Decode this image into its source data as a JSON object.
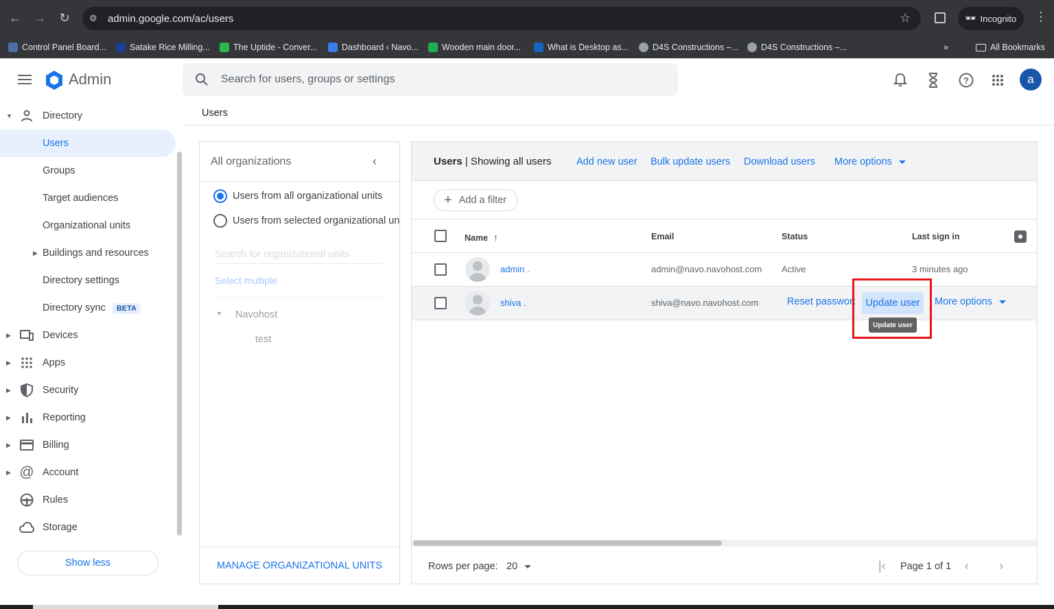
{
  "browser": {
    "url": "admin.google.com/ac/users",
    "incognito_label": "Incognito",
    "all_bookmarks_label": "All Bookmarks",
    "bookmarks": [
      {
        "label": "Control Panel Board...",
        "color": "#4a6fa5"
      },
      {
        "label": "Satake Rice Milling...",
        "color": "#1c3f94"
      },
      {
        "label": "The Uptide - Conver...",
        "color": "#2db84d"
      },
      {
        "label": "Dashboard ‹ Navo...",
        "color": "#3b7ded"
      },
      {
        "label": "Wooden main door...",
        "color": "#1fae52"
      },
      {
        "label": "What is Desktop as...",
        "color": "#1565c0"
      },
      {
        "label": "D4S Constructions –...",
        "color": "#9aa0a6"
      },
      {
        "label": "D4S Constructions –...",
        "color": "#9aa0a6"
      }
    ]
  },
  "header": {
    "app_title": "Admin",
    "search_placeholder": "Search for users, groups or settings",
    "avatar_letter": "a",
    "brand_color": "#1a73e8"
  },
  "sidebar": {
    "items": [
      {
        "label": "Directory",
        "icon": "person-icon"
      },
      {
        "label": "Users"
      },
      {
        "label": "Groups"
      },
      {
        "label": "Target audiences"
      },
      {
        "label": "Organizational units"
      },
      {
        "label": "Buildings and resources"
      },
      {
        "label": "Directory settings"
      },
      {
        "label": "Directory sync",
        "badge": "BETA"
      },
      {
        "label": "Devices",
        "icon": "devices-icon"
      },
      {
        "label": "Apps",
        "icon": "apps-grid-icon"
      },
      {
        "label": "Security",
        "icon": "shield-icon"
      },
      {
        "label": "Reporting",
        "icon": "bar-chart-icon"
      },
      {
        "label": "Billing",
        "icon": "credit-card-icon"
      },
      {
        "label": "Account",
        "icon": "at-sign-icon"
      },
      {
        "label": "Rules",
        "icon": "steering-icon"
      },
      {
        "label": "Storage",
        "icon": "cloud-icon"
      }
    ],
    "show_less": "Show less"
  },
  "breadcrumb": "Users",
  "org_panel": {
    "title": "All organizations",
    "radio_all": "Users from all organizational units",
    "radio_selected": "Users from selected organizational un",
    "search_placeholder": "Search for organizational units",
    "select_multiple": "Select multiple",
    "tree_root": "Navohost",
    "tree_child": "test",
    "manage": "MANAGE ORGANIZATIONAL UNITS"
  },
  "users_panel": {
    "title_bold": "Users",
    "title_rest": " | Showing all users",
    "add_user": "Add new user",
    "bulk_update": "Bulk update users",
    "download": "Download users",
    "more_options": "More options",
    "add_filter": "Add a filter",
    "columns": {
      "name": "Name",
      "email": "Email",
      "status": "Status",
      "last_sign_in": "Last sign in"
    },
    "rows": [
      {
        "name": "admin .",
        "email": "admin@navo.navohost.com",
        "status": "Active",
        "last_sign_in": "3 minutes ago"
      },
      {
        "name": "shiva .",
        "email": "shiva@navo.navohost.com",
        "reset_password": "Reset password",
        "update_user": "Update user",
        "more_options": "More options"
      }
    ],
    "tooltip": "Update user",
    "rows_per_page_label": "Rows per page:",
    "rows_per_page_value": "20",
    "page_label": "Page 1 of 1"
  }
}
